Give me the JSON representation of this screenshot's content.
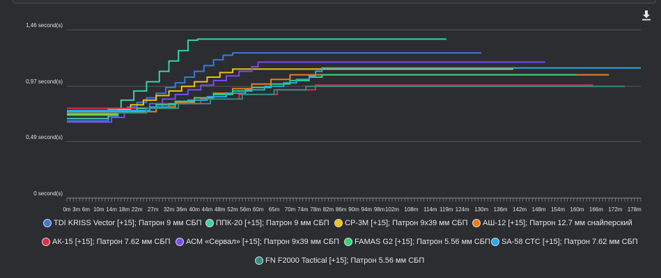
{
  "chart_data": {
    "type": "line",
    "step": true,
    "x_unit": "m",
    "y_unit": "second(s)",
    "ylim": [
      0,
      1.46
    ],
    "xlim": [
      0,
      180
    ],
    "y_ticks": [
      "0 second(s)",
      "0,49 second(s)",
      "0,97 second(s)",
      "1,46 second(s)"
    ],
    "y_tick_values": [
      0,
      0.49,
      0.97,
      1.46
    ],
    "x_ticks": [
      "0m",
      "3m",
      "6m",
      "10m",
      "14m",
      "18m",
      "22m",
      "27m",
      "32m",
      "36m",
      "40m",
      "44m",
      "48m",
      "52m",
      "56m",
      "60m",
      "65m",
      "70m",
      "74m",
      "78m",
      "82m",
      "86m",
      "90m",
      "94m",
      "98m",
      "102m",
      "108m",
      "114m",
      "119m",
      "124m",
      "130m",
      "136m",
      "142m",
      "148m",
      "154m",
      "160m",
      "166m",
      "172m",
      "178m"
    ],
    "x_tick_values": [
      0,
      3,
      6,
      10,
      14,
      18,
      22,
      27,
      32,
      36,
      40,
      44,
      48,
      52,
      56,
      60,
      65,
      70,
      74,
      78,
      82,
      86,
      90,
      94,
      98,
      102,
      108,
      114,
      119,
      124,
      130,
      136,
      142,
      148,
      154,
      160,
      166,
      172,
      178
    ],
    "grid": true,
    "legend_position": "bottom",
    "series": [
      {
        "name": "TDI KRISS Vector [+15]; Патрон 9 мм СБП",
        "color": "#3d78de",
        "points": [
          [
            0,
            0.67
          ],
          [
            10,
            0.67
          ],
          [
            13,
            0.71
          ],
          [
            16,
            0.75
          ],
          [
            19,
            0.79
          ],
          [
            22,
            0.83
          ],
          [
            25,
            0.87
          ],
          [
            28,
            0.91
          ],
          [
            31,
            0.96
          ],
          [
            34,
            1.0
          ],
          [
            37,
            1.05
          ],
          [
            40,
            1.1
          ],
          [
            43,
            1.15
          ],
          [
            46,
            1.2
          ],
          [
            49,
            1.24
          ],
          [
            52,
            1.26
          ],
          [
            130,
            1.26
          ]
        ]
      },
      {
        "name": "ППК-20 [+15]; Патрон 9 мм СБП",
        "color": "#36d4aa",
        "points": [
          [
            0,
            0.69
          ],
          [
            9,
            0.69
          ],
          [
            13,
            0.77
          ],
          [
            17,
            0.85
          ],
          [
            21,
            0.93
          ],
          [
            25,
            1.01
          ],
          [
            29,
            1.1
          ],
          [
            32,
            1.19
          ],
          [
            35,
            1.28
          ],
          [
            38,
            1.37
          ],
          [
            41,
            1.38
          ],
          [
            119,
            1.38
          ]
        ]
      },
      {
        "name": "СР-3М [+15]; Патрон 9х39 мм СБП",
        "color": "#f2c20f",
        "points": [
          [
            0,
            0.73
          ],
          [
            12,
            0.73
          ],
          [
            16,
            0.77
          ],
          [
            20,
            0.81
          ],
          [
            24,
            0.85
          ],
          [
            28,
            0.89
          ],
          [
            32,
            0.93
          ],
          [
            36,
            0.97
          ],
          [
            40,
            1.01
          ],
          [
            44,
            1.05
          ],
          [
            48,
            1.09
          ],
          [
            52,
            1.12
          ],
          [
            140,
            1.12
          ]
        ]
      },
      {
        "name": "АШ-12 [+15]; Патрон 12.7 мм снайперский",
        "color": "#ef7c1a",
        "points": [
          [
            0,
            0.75
          ],
          [
            22,
            0.75
          ],
          [
            28,
            0.79
          ],
          [
            34,
            0.83
          ],
          [
            40,
            0.87
          ],
          [
            46,
            0.91
          ],
          [
            52,
            0.95
          ],
          [
            58,
            0.99
          ],
          [
            64,
            1.03
          ],
          [
            70,
            1.07
          ],
          [
            170,
            1.07
          ]
        ]
      },
      {
        "name": "АК-15 [+15]; Патрон 7.62 мм СБП",
        "color": "#e02c4a",
        "points": [
          [
            0,
            0.78
          ],
          [
            18,
            0.78
          ],
          [
            30,
            0.82
          ],
          [
            42,
            0.86
          ],
          [
            54,
            0.9
          ],
          [
            66,
            0.94
          ],
          [
            78,
            0.98
          ],
          [
            165,
            0.98
          ]
        ]
      },
      {
        "name": "АСМ «Сервал» [+15]; Патрон 9х39 мм СБП",
        "color": "#7a4cf0",
        "points": [
          [
            0,
            0.66
          ],
          [
            12,
            0.66
          ],
          [
            14,
            0.7
          ],
          [
            18,
            0.74
          ],
          [
            22,
            0.78
          ],
          [
            26,
            0.82
          ],
          [
            30,
            0.86
          ],
          [
            34,
            0.9
          ],
          [
            38,
            0.94
          ],
          [
            42,
            0.98
          ],
          [
            46,
            1.02
          ],
          [
            50,
            1.06
          ],
          [
            54,
            1.1
          ],
          [
            58,
            1.14
          ],
          [
            60,
            1.18
          ],
          [
            150,
            1.18
          ]
        ]
      },
      {
        "name": "FAMAS G2 [+15]; Патрон 5.56 мм СБП",
        "color": "#2ed47a",
        "points": [
          [
            0,
            0.72
          ],
          [
            10,
            0.72
          ],
          [
            16,
            0.75
          ],
          [
            22,
            0.78
          ],
          [
            28,
            0.81
          ],
          [
            34,
            0.84
          ],
          [
            40,
            0.87
          ],
          [
            46,
            0.9
          ],
          [
            52,
            0.93
          ],
          [
            58,
            0.96
          ],
          [
            64,
            0.99
          ],
          [
            70,
            1.02
          ],
          [
            76,
            1.05
          ],
          [
            80,
            1.07
          ],
          [
            160,
            1.07
          ]
        ]
      },
      {
        "name": "SA-58 СТС [+15]; Патрон 7.62 мм СБП",
        "color": "#2aa9e6",
        "points": [
          [
            0,
            0.76
          ],
          [
            20,
            0.76
          ],
          [
            26,
            0.79
          ],
          [
            32,
            0.82
          ],
          [
            38,
            0.85
          ],
          [
            44,
            0.88
          ],
          [
            50,
            0.91
          ],
          [
            56,
            0.94
          ],
          [
            62,
            0.97
          ],
          [
            68,
            1.0
          ],
          [
            72,
            1.03
          ],
          [
            76,
            1.06
          ],
          [
            78,
            1.1
          ],
          [
            80,
            1.13
          ],
          [
            180,
            1.13
          ]
        ]
      },
      {
        "name": "FN F2000 Tactical [+15]; Патрон 5.56 мм СБП",
        "color": "#2e8f85",
        "points": [
          [
            0,
            0.74
          ],
          [
            15,
            0.74
          ],
          [
            25,
            0.78
          ],
          [
            35,
            0.82
          ],
          [
            45,
            0.86
          ],
          [
            55,
            0.9
          ],
          [
            65,
            0.94
          ],
          [
            75,
            0.97
          ],
          [
            175,
            0.97
          ]
        ]
      }
    ]
  },
  "icons": {
    "download": "download-icon"
  }
}
